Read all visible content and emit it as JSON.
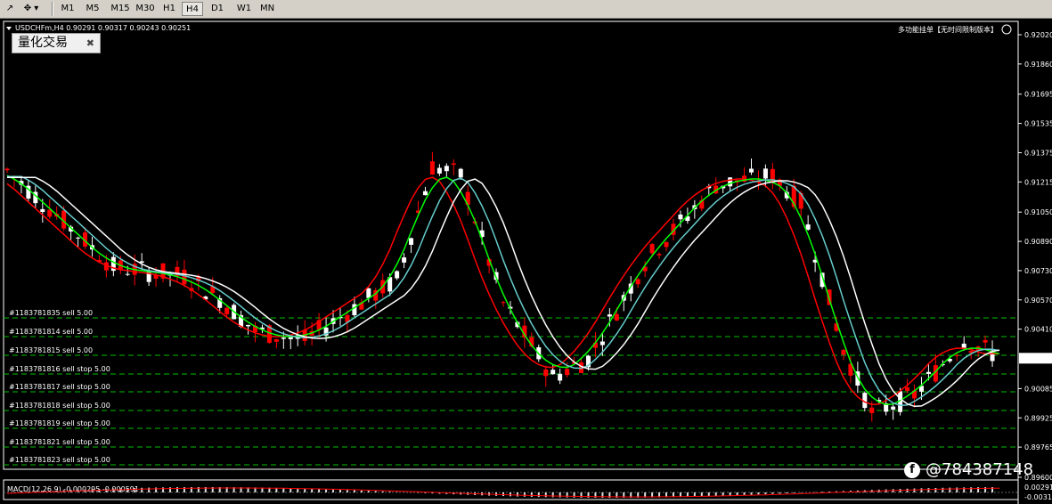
{
  "toolbar": {
    "timeframes": [
      "M1",
      "M5",
      "M15",
      "M30",
      "H1",
      "H4",
      "D1",
      "W1",
      "MN"
    ],
    "active": "H4"
  },
  "chart": {
    "header": "USDCHFm,H4  0.90291 0.90317 0.90243 0.90251",
    "expert_label": "多功能挂单【无时间限制版本】",
    "ea_box_label": "量化交易",
    "current_price": "0.90251",
    "price_axis": [
      "0.92020",
      "0.91860",
      "0.91695",
      "0.91535",
      "0.91375",
      "0.91215",
      "0.91050",
      "0.90890",
      "0.90730",
      "0.90570",
      "0.90410",
      "0.90085",
      "0.89925",
      "0.89765",
      "0.89600"
    ],
    "orders": [
      "#1183781835 sell 5.00",
      "#1183781814 sell 5.00",
      "#1183781815 sell 5.00",
      "#1183781816 sell stop 5.00",
      "#1183781817 sell stop 5.00",
      "#1183781818 sell stop 5.00",
      "#1183781819 sell stop 5.00",
      "#1183781821 sell stop 5.00",
      "#1183781823 sell stop 5.00"
    ],
    "macd_label": "MACD(12,26,9) -0.000295 -0.000591",
    "macd_axis": [
      "0.00291",
      "-0.00316"
    ],
    "watermark": "@784387148",
    "colors": {
      "bull": "#ff0000",
      "bear": "#ffffff",
      "grid": "#00c000",
      "ma_red": "#ff0000",
      "ma_green": "#00ff00",
      "ma_cyan": "#66cccc",
      "ma_white": "#ffffff"
    }
  }
}
